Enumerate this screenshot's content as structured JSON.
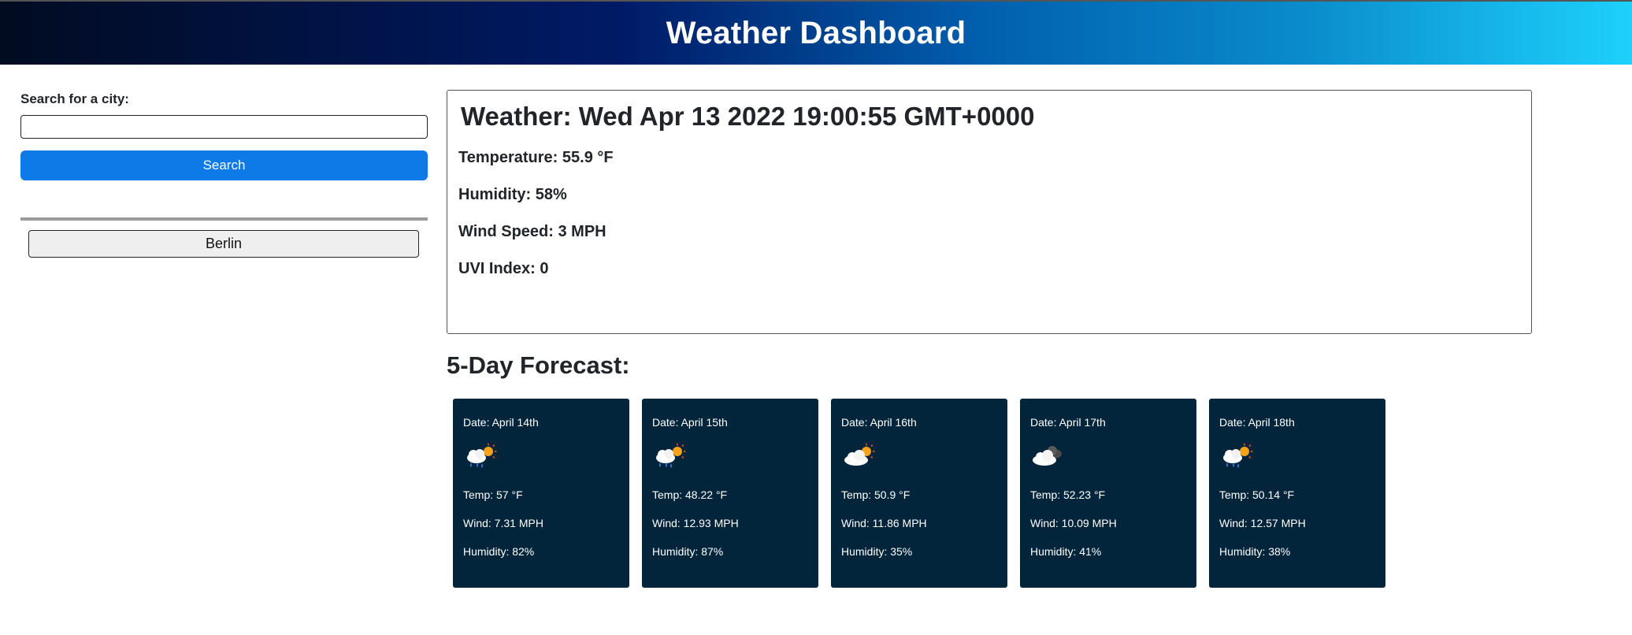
{
  "header": {
    "title": "Weather Dashboard"
  },
  "sidebar": {
    "search_label": "Search for a city:",
    "search_value": "",
    "search_placeholder": "",
    "search_button": "Search",
    "history": [
      "Berlin"
    ]
  },
  "current": {
    "title": "Weather: Wed Apr 13 2022 19:00:55 GMT+0000",
    "temperature": "Temperature: 55.9 °F",
    "humidity": "Humidity: 58%",
    "wind": "Wind Speed: 3 MPH",
    "uvi": "UVI Index: 0"
  },
  "forecast": {
    "title": "5-Day Forecast:",
    "days": [
      {
        "date": "Date: April 14th",
        "icon": "rain-sun-icon",
        "temp": "Temp: 57 °F",
        "wind": "Wind: 7.31 MPH",
        "humidity": "Humidity: 82%"
      },
      {
        "date": "Date: April 15th",
        "icon": "rain-sun-icon",
        "temp": "Temp: 48.22 °F",
        "wind": "Wind: 12.93 MPH",
        "humidity": "Humidity: 87%"
      },
      {
        "date": "Date: April 16th",
        "icon": "cloud-sun-icon",
        "temp": "Temp: 50.9 °F",
        "wind": "Wind: 11.86 MPH",
        "humidity": "Humidity: 35%"
      },
      {
        "date": "Date: April 17th",
        "icon": "broken-clouds-icon",
        "temp": "Temp: 52.23 °F",
        "wind": "Wind: 10.09 MPH",
        "humidity": "Humidity: 41%"
      },
      {
        "date": "Date: April 18th",
        "icon": "rain-sun-icon",
        "temp": "Temp: 50.14 °F",
        "wind": "Wind: 12.57 MPH",
        "humidity": "Humidity: 38%"
      }
    ]
  },
  "colors": {
    "primary_button": "#0d7ae8",
    "card_background": "#02253c"
  }
}
